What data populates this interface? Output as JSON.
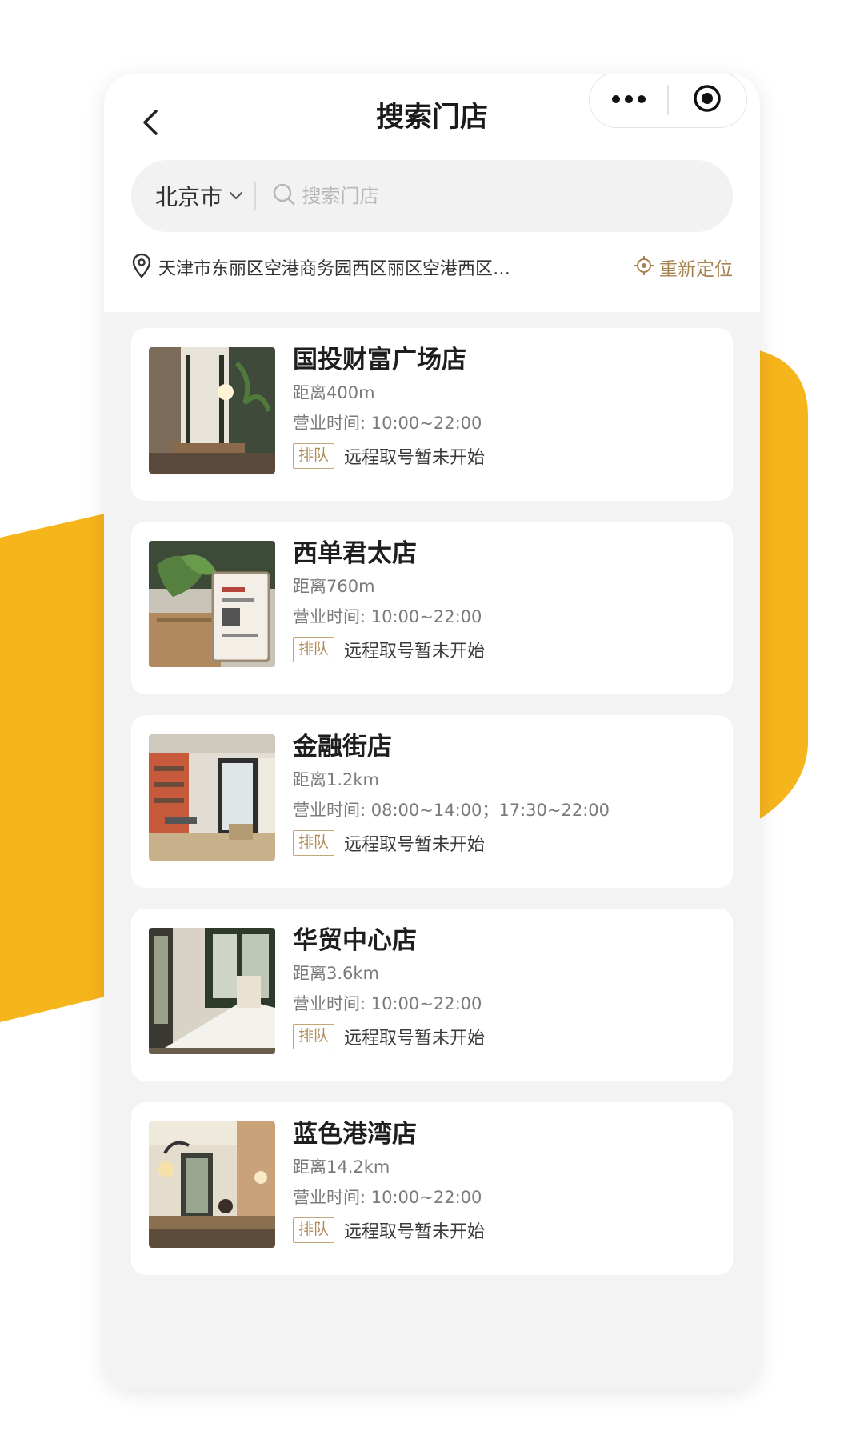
{
  "page": {
    "title": "搜索门店"
  },
  "capsule": {
    "more_icon": "more-dots-icon",
    "close_icon": "record-circle-icon"
  },
  "search": {
    "city": "北京市",
    "placeholder": "搜索门店"
  },
  "location": {
    "address": "天津市东丽区空港商务园西区丽区空港西区…",
    "relocate_label": "重新定位"
  },
  "colors": {
    "accent_yellow": "#F7B51C",
    "gold_text": "#A68350",
    "page_bg": "#F3F3F3"
  },
  "stores": [
    {
      "name": "国投财富广场店",
      "distance": "距离400m",
      "hours": "营业时间: 10:00~22:00",
      "queue_badge": "排队",
      "queue_status": "远程取号暂未开始"
    },
    {
      "name": "西单君太店",
      "distance": "距离760m",
      "hours": "营业时间: 10:00~22:00",
      "queue_badge": "排队",
      "queue_status": "远程取号暂未开始"
    },
    {
      "name": "金融街店",
      "distance": "距离1.2km",
      "hours": "营业时间: 08:00~14:00；17:30~22:00",
      "queue_badge": "排队",
      "queue_status": "远程取号暂未开始"
    },
    {
      "name": "华贸中心店",
      "distance": "距离3.6km",
      "hours": "营业时间: 10:00~22:00",
      "queue_badge": "排队",
      "queue_status": "远程取号暂未开始"
    },
    {
      "name": "蓝色港湾店",
      "distance": "距离14.2km",
      "hours": "营业时间: 10:00~22:00",
      "queue_badge": "排队",
      "queue_status": "远程取号暂未开始"
    }
  ]
}
